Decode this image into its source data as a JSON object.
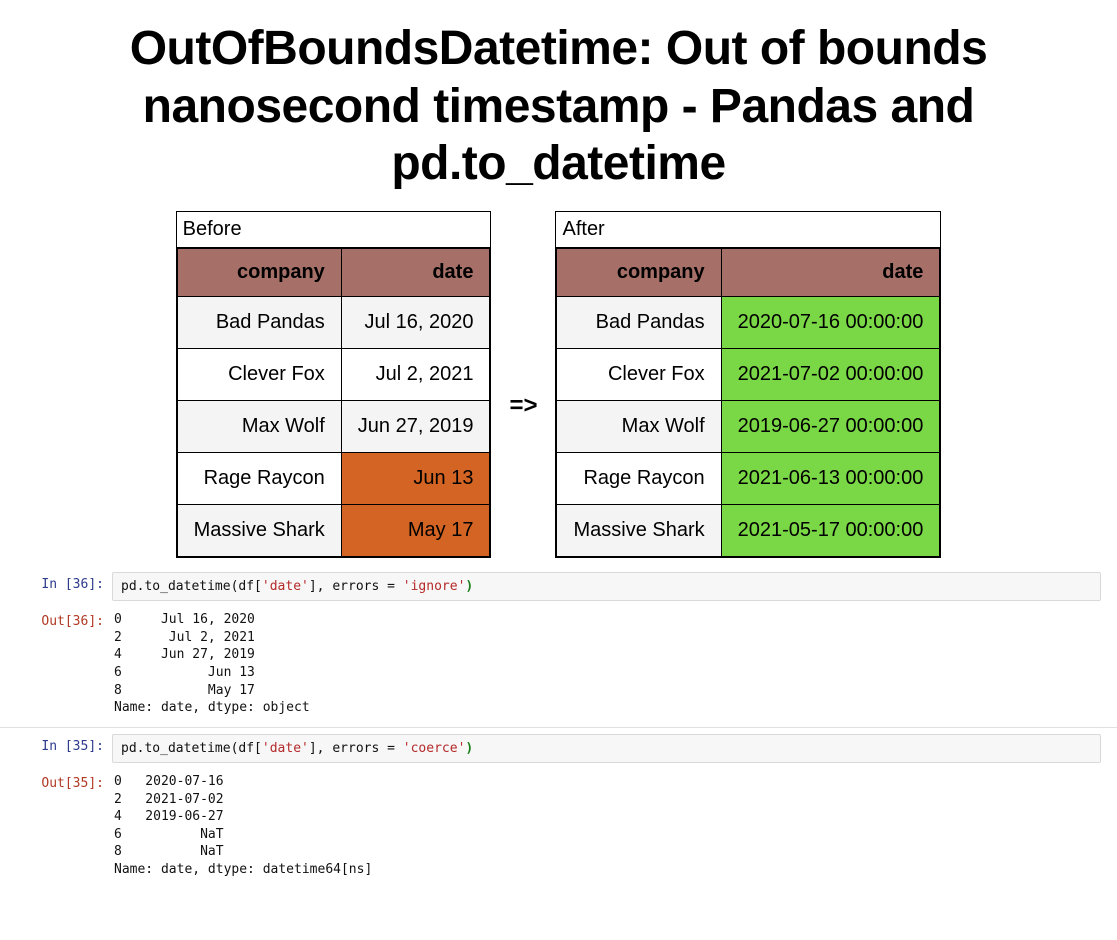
{
  "title": "OutOfBoundsDatetime: Out of bounds nanosecond timestamp - Pandas and pd.to_datetime",
  "arrow": "=>",
  "tables": {
    "before": {
      "caption": "Before",
      "headers": {
        "company": "company",
        "date": "date"
      },
      "rows": [
        {
          "company": "Bad Pandas",
          "date": "Jul 16, 2020",
          "date_hl": "none"
        },
        {
          "company": "Clever Fox",
          "date": "Jul 2, 2021",
          "date_hl": "none"
        },
        {
          "company": "Max Wolf",
          "date": "Jun 27, 2019",
          "date_hl": "none"
        },
        {
          "company": "Rage Raycon",
          "date": "Jun 13",
          "date_hl": "orange"
        },
        {
          "company": "Massive Shark",
          "date": "May 17",
          "date_hl": "orange"
        }
      ]
    },
    "after": {
      "caption": "After",
      "headers": {
        "company": "company",
        "date": "date"
      },
      "rows": [
        {
          "company": "Bad Pandas",
          "date": "2020-07-16 00:00:00",
          "date_hl": "green"
        },
        {
          "company": "Clever Fox",
          "date": "2021-07-02 00:00:00",
          "date_hl": "green"
        },
        {
          "company": "Max Wolf",
          "date": "2019-06-27 00:00:00",
          "date_hl": "green"
        },
        {
          "company": "Rage Raycon",
          "date": "2021-06-13 00:00:00",
          "date_hl": "green"
        },
        {
          "company": "Massive Shark",
          "date": "2021-05-17 00:00:00",
          "date_hl": "green"
        }
      ]
    }
  },
  "cells": [
    {
      "prompt_in": "In [36]:",
      "prompt_out": "Out[36]:",
      "code": {
        "prefix": "pd.to_datetime(df[",
        "str1": "'date'",
        "mid": "], errors = ",
        "str2": "'ignore'",
        "close": ")"
      },
      "output": "0     Jul 16, 2020\n2      Jul 2, 2021\n4     Jun 27, 2019\n6           Jun 13\n8           May 17\nName: date, dtype: object"
    },
    {
      "prompt_in": "In [35]:",
      "prompt_out": "Out[35]:",
      "code": {
        "prefix": "pd.to_datetime(df[",
        "str1": "'date'",
        "mid": "], errors = ",
        "str2": "'coerce'",
        "close": ")"
      },
      "output": "0   2020-07-16\n2   2021-07-02\n4   2019-06-27\n6          NaT\n8          NaT\nName: date, dtype: datetime64[ns]"
    }
  ]
}
